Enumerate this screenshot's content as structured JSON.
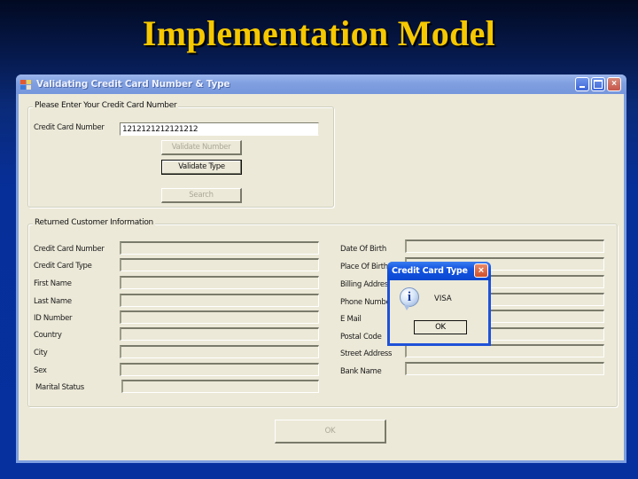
{
  "slide": {
    "title": "Implementation Model"
  },
  "window": {
    "title": "Validating Credit Card Number & Type",
    "icon": "app-form-icon",
    "controls": {
      "minimize": "minimize-icon",
      "maximize": "maximize-icon",
      "close": "×"
    }
  },
  "input_group": {
    "label": "Please Enter Your Credit Card Number",
    "card_number_label": "Credit Card Number",
    "card_number_value": "1212121212121212",
    "validate_number_label": "Validate Number",
    "validate_type_label": "Validate Type",
    "search_label": "Search"
  },
  "customer_group": {
    "label": "Returned Customer Information",
    "left_fields": [
      {
        "label": "Credit Card Number",
        "value": ""
      },
      {
        "label": "Credit Card Type",
        "value": ""
      },
      {
        "label": "First Name",
        "value": ""
      },
      {
        "label": "Last Name",
        "value": ""
      },
      {
        "label": "ID Number",
        "value": ""
      },
      {
        "label": "Country",
        "value": ""
      },
      {
        "label": "City",
        "value": ""
      },
      {
        "label": "Sex",
        "value": ""
      },
      {
        "label": "Marital Status",
        "value": ""
      }
    ],
    "right_fields": [
      {
        "label": "Date Of Birth",
        "value": ""
      },
      {
        "label": "Place Of Birth",
        "value": ""
      },
      {
        "label": "Billing Address",
        "value": ""
      },
      {
        "label": "Phone Number",
        "value": ""
      },
      {
        "label": "E Mail",
        "value": ""
      },
      {
        "label": "Postal Code",
        "value": ""
      },
      {
        "label": "Street Address",
        "value": ""
      },
      {
        "label": "Bank Name",
        "value": ""
      }
    ]
  },
  "footer": {
    "ok_label": "OK"
  },
  "message_box": {
    "title": "Credit Card Type",
    "icon": "info-icon",
    "message": "VISA",
    "ok_label": "OK",
    "close": "×",
    "info_glyph": "i"
  }
}
